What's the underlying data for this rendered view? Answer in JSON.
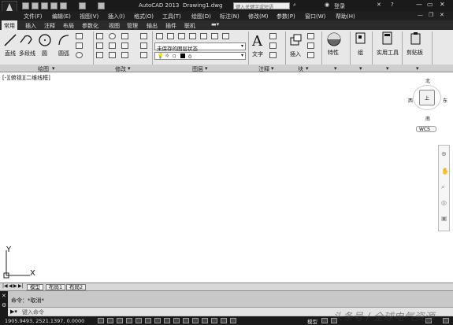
{
  "app": {
    "title": "AutoCAD 2013",
    "document": "Drawing1.dwg",
    "search_placeholder": "键入关键字或短语",
    "login_label": "登录"
  },
  "menu": {
    "items": [
      "文件(F)",
      "编辑(E)",
      "视图(V)",
      "插入(I)",
      "格式(O)",
      "工具(T)",
      "绘图(D)",
      "标注(N)",
      "修改(M)",
      "参数(P)",
      "窗口(W)",
      "帮助(H)"
    ]
  },
  "ribbon": {
    "tabs": [
      "常用",
      "插入",
      "注释",
      "布局",
      "参数化",
      "视图",
      "管理",
      "输出",
      "插件",
      "联机"
    ],
    "active_tab": "常用",
    "draw_tools": [
      "直线",
      "多段线",
      "圆",
      "圆弧"
    ],
    "layer_state": "未保存的图层状态",
    "layer_current": "0",
    "annotation_tools": [
      "文字"
    ],
    "block_tools": [
      "插入"
    ],
    "properties_label": "特性",
    "group_label": "组",
    "utilities_label": "实用工具",
    "clipboard_label": "剪贴板",
    "panels": [
      "绘图",
      "修改",
      "图层",
      "注释",
      "块"
    ]
  },
  "viewport": {
    "label": "[-][俯视][二维线框]",
    "compass": {
      "north": "北",
      "south": "南",
      "west": "西",
      "east": "东",
      "center": "上"
    },
    "wcs": "WCS",
    "axis_y": "Y",
    "axis_x": "X"
  },
  "layout_tabs": [
    "模型",
    "布局1",
    "布局2"
  ],
  "command": {
    "history": "命令：*取消*",
    "prompt": "键入命令"
  },
  "status": {
    "coords": "1905.9493, 2521.1397, 0.0000",
    "model_label": "模型"
  },
  "watermark": "头条号 / 全球电气资源"
}
